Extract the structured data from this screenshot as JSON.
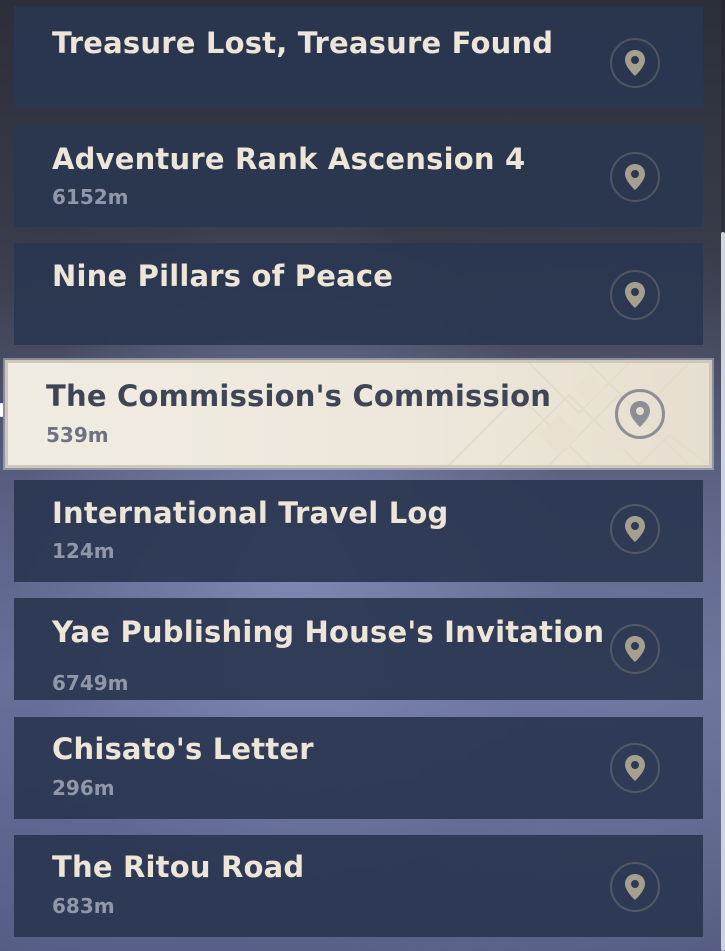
{
  "quests": [
    {
      "title": "Treasure Lost, Treasure Found",
      "distance": "",
      "icon": "location-pin-icon",
      "selected": false
    },
    {
      "title": "Adventure Rank Ascension 4",
      "distance": "6152m",
      "icon": "location-pin-icon",
      "selected": false
    },
    {
      "title": "Nine Pillars of Peace",
      "distance": "",
      "icon": "location-pin-icon",
      "selected": false
    },
    {
      "title": "The Commission's Commission",
      "distance": "539m",
      "icon": "location-pin-icon",
      "selected": true
    },
    {
      "title": "International Travel Log",
      "distance": "124m",
      "icon": "location-pin-icon",
      "selected": false
    },
    {
      "title": "Yae Publishing House's Invitation",
      "distance": "6749m",
      "icon": "location-pin-icon",
      "selected": false
    },
    {
      "title": "Chisato's Letter",
      "distance": "296m",
      "icon": "location-pin-icon",
      "selected": false
    },
    {
      "title": "The Ritou Road",
      "distance": "683m",
      "icon": "location-pin-icon",
      "selected": false
    }
  ],
  "colors": {
    "row_background": "#2a3650",
    "title_text": "#ece5d8",
    "distance_text": "#8f97a8",
    "selected_background": "#f1ece2",
    "selected_title_text": "#3e4557",
    "pin_color": "#a59f8e",
    "selected_pin_color": "#8e8f96"
  }
}
